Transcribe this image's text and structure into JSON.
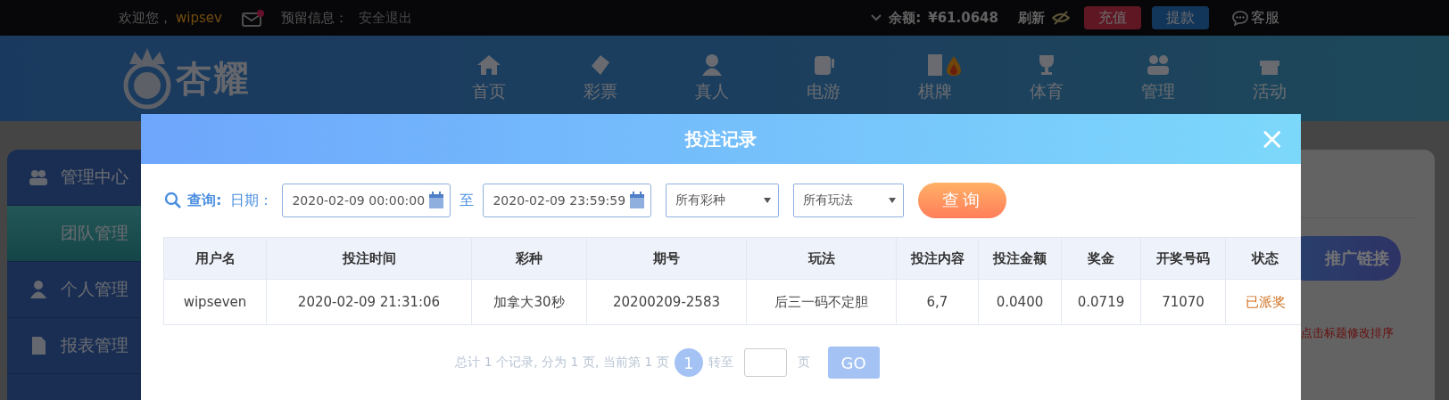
{
  "top_bar": {
    "welcome": "欢迎您，",
    "username": "wipsev",
    "mail": {
      "unread": true
    },
    "reserved_info": "预留信息：",
    "logout": "安全退出",
    "balance_label": "余额:",
    "balance": "¥61.0648",
    "refresh": "刷新",
    "deposit": "充值",
    "withdraw": "提款",
    "service": "客服"
  },
  "logo": {
    "text": "杏耀"
  },
  "nav": [
    {
      "label": "首页",
      "hot": false
    },
    {
      "label": "彩票",
      "hot": false
    },
    {
      "label": "真人",
      "hot": false
    },
    {
      "label": "电游",
      "hot": false
    },
    {
      "label": "棋牌",
      "hot": true
    },
    {
      "label": "体育",
      "hot": false
    },
    {
      "label": "管理",
      "hot": false
    },
    {
      "label": "活动",
      "hot": false
    }
  ],
  "sidebar": {
    "items": [
      {
        "label": "管理中心",
        "selected": false,
        "children": [
          {
            "label": "团队管理",
            "selected": true
          }
        ]
      },
      {
        "label": "个人管理",
        "selected": false
      },
      {
        "label": "报表管理",
        "selected": false
      }
    ]
  },
  "panel": {
    "promo_button": "推广链接",
    "hint": "点击标题修改排序"
  },
  "modal": {
    "title": "投注记录",
    "close": "×",
    "filters": {
      "query_label": "查询:",
      "date_label": "日期：",
      "date_from": "2020-02-09 00:00:00",
      "to": "至",
      "date_to": "2020-02-09 23:59:59",
      "lottery_select": "所有彩种",
      "play_select": "所有玩法",
      "search_button": "查询"
    },
    "table": {
      "columns": [
        "用户名",
        "投注时间",
        "彩种",
        "期号",
        "玩法",
        "投注内容",
        "投注金额",
        "奖金",
        "开奖号码",
        "状态"
      ],
      "rows": [
        [
          "wipseven",
          "2020-02-09 21:31:06",
          "加拿大30秒",
          "20200209-2583",
          "后三一码不定胆",
          "6,7",
          "0.0400",
          "0.0719",
          "71070",
          "已派奖"
        ]
      ]
    },
    "pagination": {
      "summary": "总计 1 个记录, 分为 1 页, 当前第 1 页",
      "pages": [
        {
          "label": "1",
          "selected": true
        }
      ],
      "goto_label": "转至",
      "page_suffix": "页",
      "go_button": "GO"
    }
  }
}
